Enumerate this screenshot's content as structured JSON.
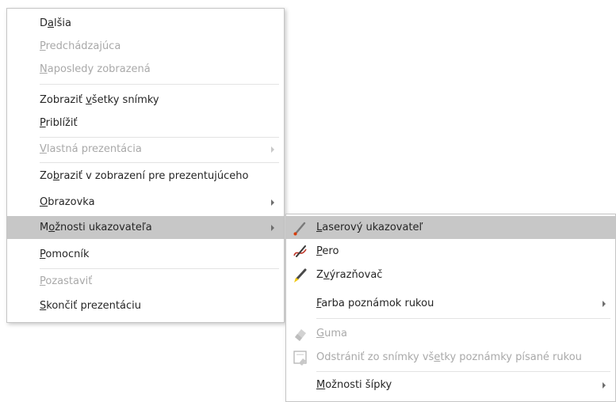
{
  "main_menu": {
    "items": [
      {
        "pre": "D",
        "key": "a",
        "post": "lšia"
      },
      {
        "pre": "",
        "key": "P",
        "post": "redchádzajúca"
      },
      {
        "pre": "",
        "key": "N",
        "post": "aposledy zobrazená"
      },
      {
        "pre": "Zobraziť ",
        "key": "v",
        "post": "šetky snímky"
      },
      {
        "pre": "",
        "key": "P",
        "post": "riblížiť"
      },
      {
        "pre": "",
        "key": "V",
        "post": "lastná prezentácia"
      },
      {
        "pre": "Zo",
        "key": "b",
        "post": "raziť v zobrazení pre prezentujúceho"
      },
      {
        "pre": "",
        "key": "O",
        "post": "brazovka"
      },
      {
        "pre": "M",
        "key": "o",
        "post": "žnosti ukazovateľa"
      },
      {
        "pre": "",
        "key": "P",
        "post": "omocník"
      },
      {
        "pre": "",
        "key": "P",
        "post": "ozastaviť"
      },
      {
        "pre": "",
        "key": "S",
        "post": "končiť prezentáciu"
      }
    ]
  },
  "sub_menu": {
    "items": [
      {
        "pre": "",
        "key": "L",
        "post": "aserový ukazovateľ"
      },
      {
        "pre": "",
        "key": "P",
        "post": "ero"
      },
      {
        "pre": "Z",
        "key": "v",
        "post": "ýrazňovač"
      },
      {
        "pre": "",
        "key": "F",
        "post": "arba poznámok rukou"
      },
      {
        "pre": "",
        "key": "G",
        "post": "uma"
      },
      {
        "pre": "Odstrániť zo snímky vš",
        "key": "e",
        "post": "tky poznámky písané rukou"
      },
      {
        "pre": "",
        "key": "M",
        "post": "ožnosti šípky"
      }
    ]
  },
  "icons": {
    "laser_pointer": "laser-pointer-icon",
    "pen": "pen-icon",
    "highlighter": "highlighter-icon",
    "eraser": "eraser-icon",
    "erase_all": "erase-all-ink-icon"
  },
  "colors": {
    "highlight": "#c7c7c7",
    "disabled_text": "#a9a9a9",
    "text": "#262626",
    "laser_red": "#d83b01",
    "highlighter_yellow": "#f2c811"
  }
}
